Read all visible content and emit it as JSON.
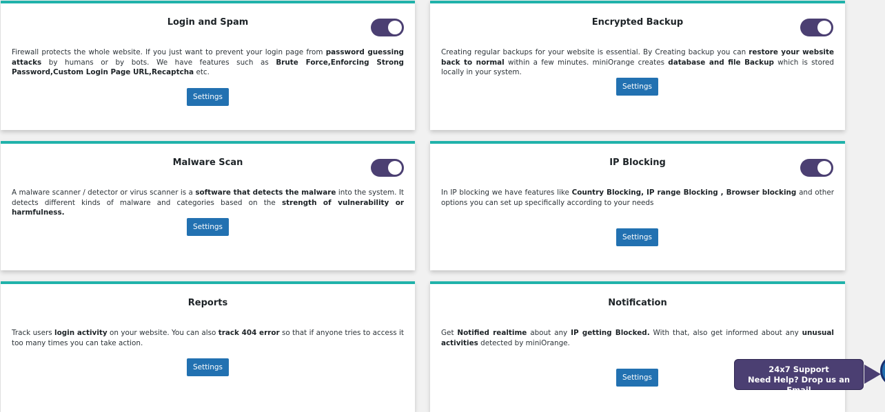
{
  "cards": [
    {
      "id": "login-spam",
      "title": "Login and Spam",
      "toggle_on": true,
      "desc": [
        {
          "t": "Firewall protects the whole website. If you just want to prevent your login page from "
        },
        {
          "t": "password guessing attacks",
          "b": true
        },
        {
          "t": " by humans or by bots. We have features such as "
        },
        {
          "t": "Brute Force,Enforcing Strong Password,Custom Login Page URL,Recaptcha",
          "b": true
        },
        {
          "t": " etc."
        }
      ],
      "button_label": "Settings"
    },
    {
      "id": "encrypted-backup",
      "title": "Encrypted Backup",
      "toggle_on": true,
      "desc": [
        {
          "t": "Creating regular backups for your website is essential. By Creating backup you can "
        },
        {
          "t": "restore your website back to normal",
          "b": true
        },
        {
          "t": " within a few minutes. miniOrange creates "
        },
        {
          "t": "database and file Backup",
          "b": true
        },
        {
          "t": " which is stored locally in your system."
        }
      ],
      "button_label": "Settings"
    },
    {
      "id": "malware-scan",
      "title": "Malware Scan",
      "toggle_on": true,
      "desc": [
        {
          "t": "A malware scanner / detector or virus scanner is a "
        },
        {
          "t": "software that detects the malware",
          "b": true
        },
        {
          "t": " into the system. It detects different kinds of malware and categories based on the "
        },
        {
          "t": "strength of vulnerability or harmfulness.",
          "b": true
        }
      ],
      "button_label": "Settings"
    },
    {
      "id": "ip-blocking",
      "title": "IP Blocking",
      "toggle_on": true,
      "desc": [
        {
          "t": "In IP blocking we have features like "
        },
        {
          "t": "Country Blocking, IP range Blocking , Browser blocking",
          "b": true
        },
        {
          "t": " and other options you can set up specifically according to your needs"
        }
      ],
      "button_label": "Settings"
    },
    {
      "id": "reports",
      "title": "Reports",
      "toggle_on": false,
      "desc": [
        {
          "t": "Track users "
        },
        {
          "t": "login activity",
          "b": true
        },
        {
          "t": " on your website. You can also "
        },
        {
          "t": "track 404 error",
          "b": true
        },
        {
          "t": " so that if anyone tries to access it too many times you can take action."
        }
      ],
      "button_label": "Settings"
    },
    {
      "id": "notification",
      "title": "Notification",
      "toggle_on": false,
      "desc": [
        {
          "t": "Get "
        },
        {
          "t": "Notified realtime",
          "b": true
        },
        {
          "t": " about any "
        },
        {
          "t": "IP getting Blocked.",
          "b": true
        },
        {
          "t": " With that, also get informed about any "
        },
        {
          "t": "unusual activities",
          "b": true
        },
        {
          "t": " detected by miniOrange."
        }
      ],
      "button_label": "Settings"
    }
  ],
  "support": {
    "line1": "24x7 Support",
    "line2": "Need Help? Drop us an Email"
  },
  "colors": {
    "accent_border": "#20b2aa",
    "toggle_on": "#4b3f72",
    "button": "#2271b1"
  }
}
